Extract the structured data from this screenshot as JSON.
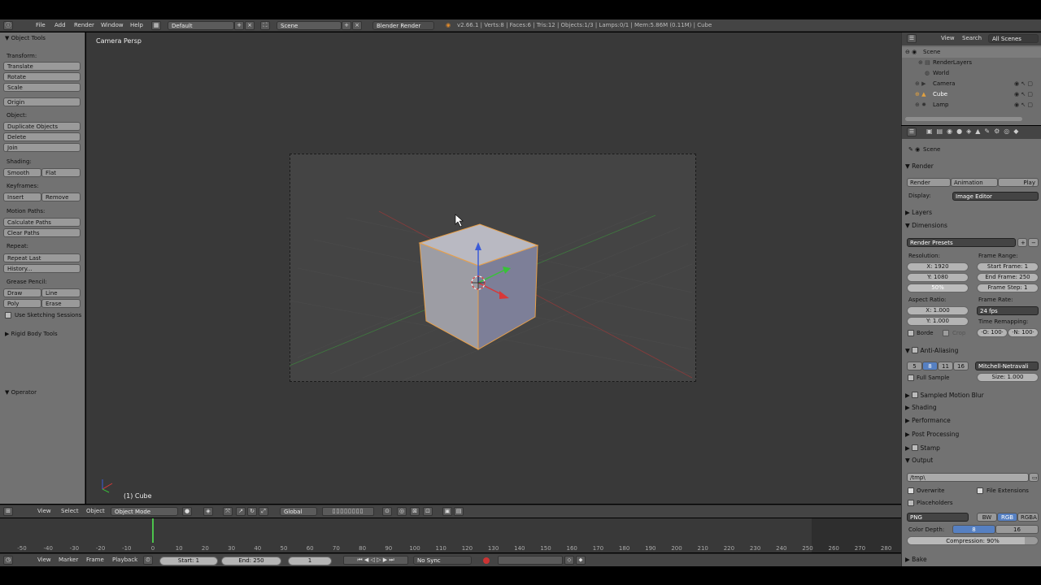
{
  "top_header": {
    "menus": [
      "File",
      "Add",
      "Render",
      "Window",
      "Help"
    ],
    "layout": "Default",
    "scene": "Scene",
    "engine": "Blender Render",
    "stats": "v2.66.1 | Verts:8 | Faces:6 | Tris:12 | Objects:1/3 | Lamps:0/1 | Mem:5.86M (0.11M) | Cube"
  },
  "tool_shelf": {
    "title": "Object Tools",
    "transform_label": "Transform:",
    "translate": "Translate",
    "rotate": "Rotate",
    "scale": "Scale",
    "origin": "Origin",
    "object_label": "Object:",
    "duplicate": "Duplicate Objects",
    "delete": "Delete",
    "join": "Join",
    "shading_label": "Shading:",
    "smooth": "Smooth",
    "flat": "Flat",
    "keyframes_label": "Keyframes:",
    "insert": "Insert",
    "remove": "Remove",
    "motion_label": "Motion Paths:",
    "calc_paths": "Calculate Paths",
    "clear_paths": "Clear Paths",
    "repeat_label": "Repeat:",
    "repeat_last": "Repeat Last",
    "history": "History...",
    "grease_label": "Grease Pencil:",
    "draw": "Draw",
    "line": "Line",
    "poly": "Poly",
    "erase": "Erase",
    "sketching": "Use Sketching Sessions",
    "rigid": "Rigid Body Tools",
    "operator": "Operator"
  },
  "viewport": {
    "view_name": "Camera Persp",
    "object_label": "(1) Cube"
  },
  "viewport_header": {
    "view": "View",
    "select": "Select",
    "object": "Object",
    "mode": "Object Mode",
    "orientation": "Global"
  },
  "timeline": {
    "ticks": [
      "-50",
      "-40",
      "-30",
      "-20",
      "-10",
      "0",
      "10",
      "20",
      "30",
      "40",
      "50",
      "60",
      "70",
      "80",
      "90",
      "100",
      "110",
      "120",
      "130",
      "140",
      "150",
      "160",
      "170",
      "180",
      "190",
      "200",
      "210",
      "220",
      "230",
      "240",
      "250",
      "260",
      "270",
      "280"
    ],
    "view": "View",
    "marker": "Marker",
    "frame": "Frame",
    "playback": "Playback",
    "start": "Start: 1",
    "end": "End: 250",
    "current": "1",
    "sync": "No Sync"
  },
  "outliner": {
    "view": "View",
    "search": "Search",
    "filter": "All Scenes",
    "items": [
      "Scene",
      "RenderLayers",
      "World",
      "Camera",
      "Cube",
      "Lamp"
    ]
  },
  "properties": {
    "context": "Scene",
    "render_panel": "Render",
    "render_btn": "Render",
    "animation_btn": "Animation",
    "play_btn": "Play",
    "display_label": "Display:",
    "display_value": "Image Editor",
    "layers": "Layers",
    "dimensions": "Dimensions",
    "presets": "Render Presets",
    "resolution_label": "Resolution:",
    "res_x": "X: 1920",
    "res_y": "Y: 1080",
    "res_pct": "50%",
    "frame_range_label": "Frame Range:",
    "start_frame": "Start Frame: 1",
    "end_frame": "End Frame: 250",
    "frame_step": "Frame Step: 1",
    "aspect_label": "Aspect Ratio:",
    "aspect_x": "X: 1.000",
    "aspect_y": "Y: 1.000",
    "frame_rate_label": "Frame Rate:",
    "fps": "24 fps",
    "remap_label": "Time Remapping:",
    "remap_old": "·O: 100·",
    "remap_new": "·N: 100·",
    "border": "Borde",
    "crop": "Crop",
    "aa": "Anti-Aliasing",
    "aa_samples": [
      "5",
      "8",
      "11",
      "16"
    ],
    "filter": "Mitchell-Netravali",
    "full_sample": "Full Sample",
    "size": "Size: 1.000",
    "motion_blur": "Sampled Motion Blur",
    "shading": "Shading",
    "performance": "Performance",
    "post": "Post Processing",
    "stamp": "Stamp",
    "output": "Output",
    "path": "/tmp\\",
    "overwrite": "Overwrite",
    "file_ext": "File Extensions",
    "placeholders": "Placeholders",
    "format": "PNG",
    "bw": "BW",
    "rgb": "RGB",
    "rgba": "RGBA",
    "color_depth_label": "Color Depth:",
    "depth_8": "8",
    "depth_16": "16",
    "compression": "Compression: 90%",
    "compression_level": 0.9,
    "bake": "Bake"
  }
}
